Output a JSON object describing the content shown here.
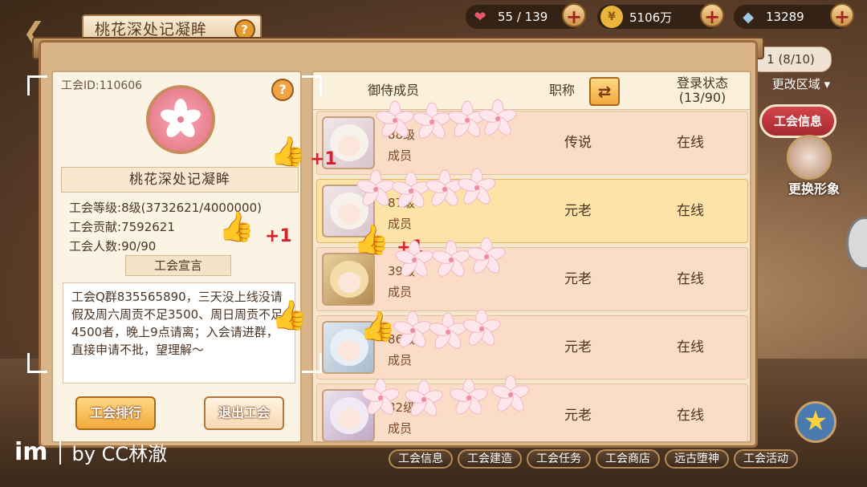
{
  "header": {
    "title": "桃花深处记凝眸",
    "help_label": "?",
    "back_icon": "back-arrow-icon",
    "resources": [
      {
        "icon": "heart-icon",
        "value": "55 / 139",
        "color": "#e85a6a"
      },
      {
        "icon": "coin-icon",
        "value": "5106万",
        "color": "#e9b53a"
      },
      {
        "icon": "crystal-icon",
        "value": "13289",
        "color": "#9ec7e6"
      }
    ],
    "plus_label": "+"
  },
  "side": {
    "tab_label": "1 (8/10)",
    "region_label": "更改区域 ▾",
    "guild_info_badge": "工会信息",
    "change_look": "更换形象"
  },
  "guild": {
    "id_label": "工会ID:110606",
    "help": "?",
    "name": "桃花深处记凝眸",
    "level_label": "工会等级:",
    "level_value": "8级(3732621/4000000)",
    "contribution_label": "工会贡献:",
    "contribution_value": "7592621",
    "members_label": "工会人数:",
    "members_value": "90/90",
    "manifesto_title": "工会宣言",
    "manifesto_text": "工会Q群835565890，三天没上线没请假及周六周贡不足3500、周日周贡不足4500者，晚上9点请离；入会请进群，直接申请不批，望理解～",
    "rank_button": "工会排行",
    "leave_button": "退出工会"
  },
  "table": {
    "headers": {
      "members": "御侍成员",
      "title": "职称",
      "status_line1": "登录状态",
      "status_line2": "(13/90)"
    },
    "swap_icon": "swap-arrows-icon",
    "rows": [
      {
        "level": "88级",
        "role": "成员",
        "title": "传说",
        "status": "在线",
        "highlight": false
      },
      {
        "level": "87级",
        "role": "成员",
        "title": "元老",
        "status": "在线",
        "highlight": true
      },
      {
        "level": "39级",
        "role": "成员",
        "title": "元老",
        "status": "在线",
        "highlight": false
      },
      {
        "level": "86级",
        "role": "成员",
        "title": "元老",
        "status": "在线",
        "highlight": false
      },
      {
        "level": "82级",
        "role": "成员",
        "title": "元老",
        "status": "在线",
        "highlight": false
      }
    ]
  },
  "bottom_nav": [
    "工会信息",
    "工会建造",
    "工会任务",
    "工会商店",
    "远古堕神",
    "工会活动"
  ],
  "watermark": {
    "logo": "im",
    "text": "by CC林澈"
  },
  "decor": {
    "plus_one": "+1",
    "thumb_icon": "thumbs-up-icon",
    "flower_icon": "cherry-blossom-icon"
  }
}
